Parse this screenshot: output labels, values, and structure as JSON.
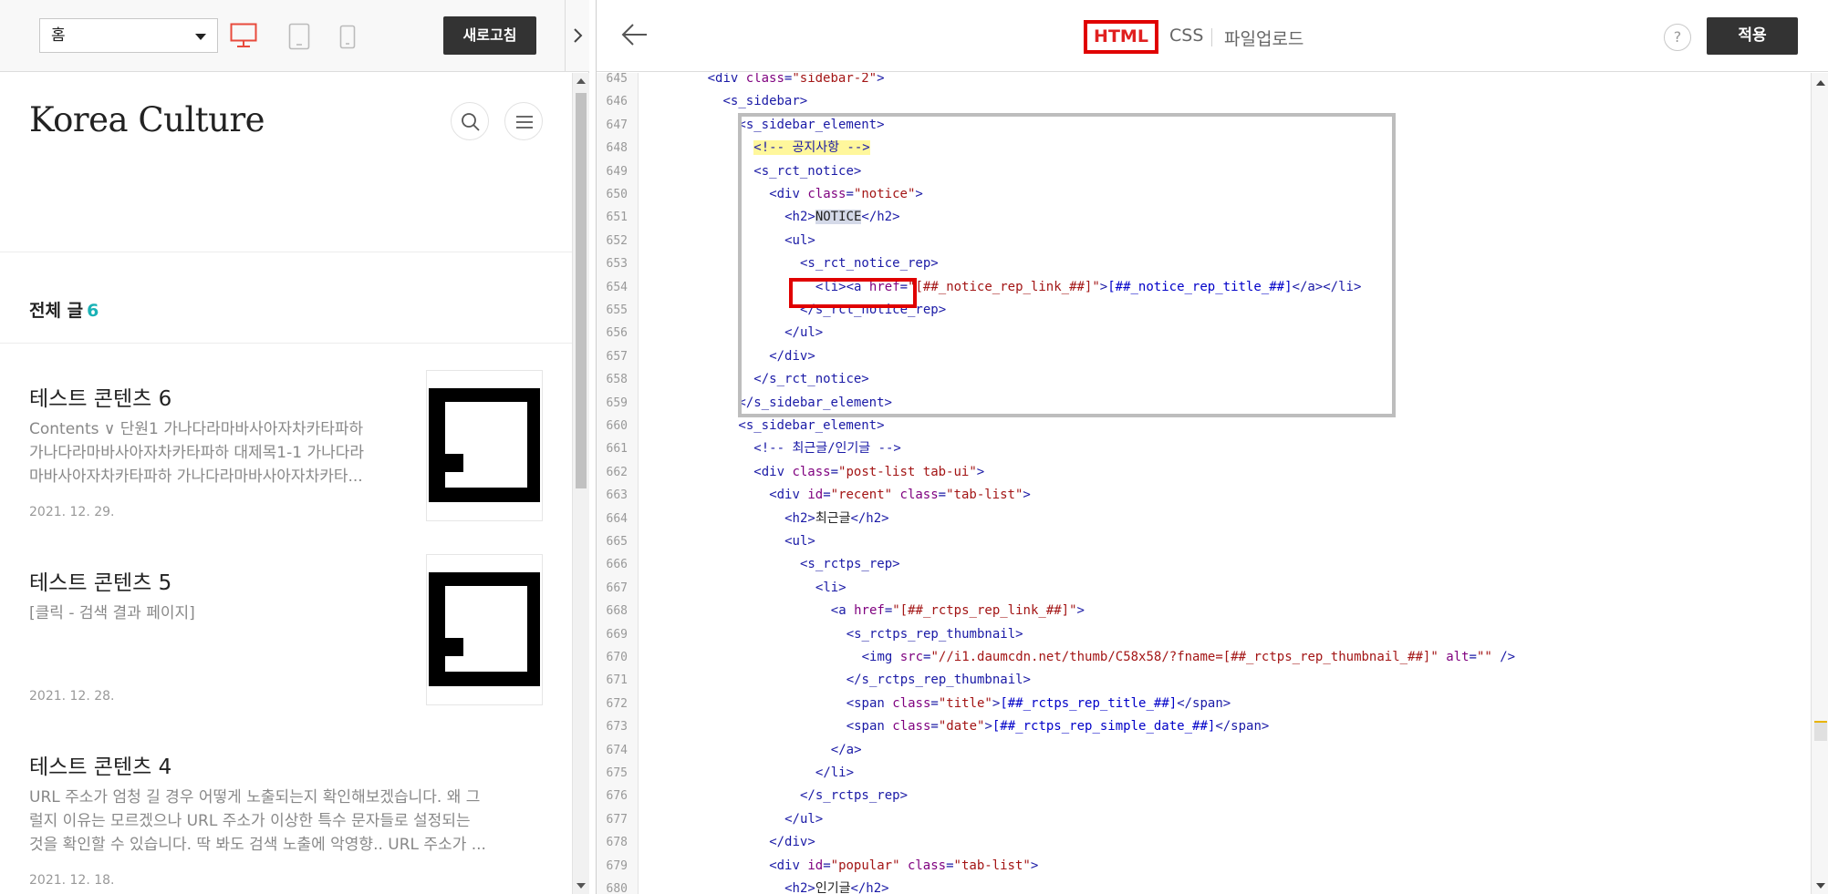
{
  "left_toolbar": {
    "page_select": "홈",
    "refresh_label": "새로고침"
  },
  "preview": {
    "blog_title": "Korea Culture",
    "total_label": "전체 글",
    "total_count": "6",
    "posts": [
      {
        "title": "테스트 콘텐츠 6",
        "excerpt_lines": [
          "Contents ∨ 단원1 가나다라마바사아자차카타파하",
          "가나다라마바사아자차카타파하 대제목1-1 가나다라",
          "마바사아자차카타파하 가나다라마바사아자차카타..."
        ],
        "date": "2021. 12. 29."
      },
      {
        "title": "테스트 콘텐츠 5",
        "excerpt_lines": [
          "[클릭 - 검색 결과 페이지]"
        ],
        "date": "2021. 12. 28."
      },
      {
        "title": "테스트 콘텐츠 4",
        "excerpt_lines": [
          "URL 주소가 엄청 길 경우 어떻게 노출되는지 확인해보겠습니다. 왜 그",
          "럴지 이유는 모르겠으나 URL 주소가 이상한 특수 문자들로 설정되는",
          "것을 확인할 수 있습니다. 딱 봐도 검색 노출에 악영향.. URL 주소가 ..."
        ],
        "date": "2021. 12. 18."
      }
    ]
  },
  "editor_toolbar": {
    "tab_html": "HTML",
    "tab_css": "CSS",
    "tab_upload": "파일업로드",
    "help": "?",
    "apply_label": "적용"
  },
  "colors": {
    "accent_red": "#e00000",
    "count_teal": "#1ab2b6",
    "button_dark": "#333333"
  },
  "code_lines": [
    {
      "n": "645",
      "indent": 4,
      "parts": [
        [
          "tag",
          "<div "
        ],
        [
          "attr",
          "class"
        ],
        [
          "tag",
          "="
        ],
        [
          "str",
          "\"sidebar-2\""
        ],
        [
          "tag",
          ">"
        ]
      ]
    },
    {
      "n": "646",
      "indent": 5,
      "parts": [
        [
          "tag",
          "<s_sidebar>"
        ]
      ]
    },
    {
      "n": "647",
      "indent": 6,
      "parts": [
        [
          "tag",
          "<s_sidebar_element>"
        ]
      ]
    },
    {
      "n": "648",
      "indent": 7,
      "parts": [
        [
          "comy",
          "<!-- 공지사항 -->"
        ]
      ]
    },
    {
      "n": "649",
      "indent": 7,
      "parts": [
        [
          "tag",
          "<s_rct_notice>"
        ]
      ]
    },
    {
      "n": "650",
      "indent": 8,
      "parts": [
        [
          "tag",
          "<div "
        ],
        [
          "attr",
          "class"
        ],
        [
          "tag",
          "="
        ],
        [
          "str",
          "\"notice\""
        ],
        [
          "tag",
          ">"
        ]
      ]
    },
    {
      "n": "651",
      "indent": 9,
      "parts": [
        [
          "tag",
          "<h2>"
        ],
        [
          "sel",
          "NOTICE"
        ],
        [
          "tag",
          "</h2>"
        ]
      ]
    },
    {
      "n": "652",
      "indent": 9,
      "parts": [
        [
          "tag",
          "<ul>"
        ]
      ]
    },
    {
      "n": "653",
      "indent": 10,
      "parts": [
        [
          "tag",
          "<s_rct_notice_rep>"
        ]
      ]
    },
    {
      "n": "654",
      "indent": 11,
      "parts": [
        [
          "tag",
          "<li><a "
        ],
        [
          "attr",
          "href"
        ],
        [
          "tag",
          "="
        ],
        [
          "str",
          "\"[##_notice_rep_link_##]\""
        ],
        [
          "tag",
          ">"
        ],
        [
          "var",
          "[##_notice_rep_title_##]"
        ],
        [
          "tag",
          "</a></li>"
        ]
      ]
    },
    {
      "n": "655",
      "indent": 10,
      "parts": [
        [
          "tag",
          "</s_rct_notice_rep>"
        ]
      ]
    },
    {
      "n": "656",
      "indent": 9,
      "parts": [
        [
          "tag",
          "</ul>"
        ]
      ]
    },
    {
      "n": "657",
      "indent": 8,
      "parts": [
        [
          "tag",
          "</div>"
        ]
      ]
    },
    {
      "n": "658",
      "indent": 7,
      "parts": [
        [
          "tag",
          "</s_rct_notice>"
        ]
      ]
    },
    {
      "n": "659",
      "indent": 6,
      "parts": [
        [
          "tag",
          "</s_sidebar_element>"
        ]
      ]
    },
    {
      "n": "660",
      "indent": 6,
      "parts": [
        [
          "tag",
          "<s_sidebar_element>"
        ]
      ]
    },
    {
      "n": "661",
      "indent": 7,
      "parts": [
        [
          "com",
          "<!-- 최근글/인기글 -->"
        ]
      ]
    },
    {
      "n": "662",
      "indent": 7,
      "parts": [
        [
          "tag",
          "<div "
        ],
        [
          "attr",
          "class"
        ],
        [
          "tag",
          "="
        ],
        [
          "str",
          "\"post-list tab-ui\""
        ],
        [
          "tag",
          ">"
        ]
      ]
    },
    {
      "n": "663",
      "indent": 8,
      "parts": [
        [
          "tag",
          "<div "
        ],
        [
          "attr",
          "id"
        ],
        [
          "tag",
          "="
        ],
        [
          "str",
          "\"recent\""
        ],
        [
          "tag",
          " "
        ],
        [
          "attr",
          "class"
        ],
        [
          "tag",
          "="
        ],
        [
          "str",
          "\"tab-list\""
        ],
        [
          "tag",
          ">"
        ]
      ]
    },
    {
      "n": "664",
      "indent": 9,
      "parts": [
        [
          "tag",
          "<h2>"
        ],
        [
          "txt",
          "최근글"
        ],
        [
          "tag",
          "</h2>"
        ]
      ]
    },
    {
      "n": "665",
      "indent": 9,
      "parts": [
        [
          "tag",
          "<ul>"
        ]
      ]
    },
    {
      "n": "666",
      "indent": 10,
      "parts": [
        [
          "tag",
          "<s_rctps_rep>"
        ]
      ]
    },
    {
      "n": "667",
      "indent": 11,
      "parts": [
        [
          "tag",
          "<li>"
        ]
      ]
    },
    {
      "n": "668",
      "indent": 12,
      "parts": [
        [
          "tag",
          "<a "
        ],
        [
          "attr",
          "href"
        ],
        [
          "tag",
          "="
        ],
        [
          "str",
          "\"[##_rctps_rep_link_##]\""
        ],
        [
          "tag",
          ">"
        ]
      ]
    },
    {
      "n": "669",
      "indent": 13,
      "parts": [
        [
          "tag",
          "<s_rctps_rep_thumbnail>"
        ]
      ]
    },
    {
      "n": "670",
      "indent": 14,
      "parts": [
        [
          "tag",
          "<img "
        ],
        [
          "attr",
          "src"
        ],
        [
          "tag",
          "="
        ],
        [
          "str",
          "\"//i1.daumcdn.net/thumb/C58x58/?fname=[##_rctps_rep_thumbnail_##]\""
        ],
        [
          "tag",
          " "
        ],
        [
          "attr",
          "alt"
        ],
        [
          "tag",
          "="
        ],
        [
          "str",
          "\"\""
        ],
        [
          "tag",
          " />"
        ]
      ]
    },
    {
      "n": "671",
      "indent": 13,
      "parts": [
        [
          "tag",
          "</s_rctps_rep_thumbnail>"
        ]
      ]
    },
    {
      "n": "672",
      "indent": 13,
      "parts": [
        [
          "tag",
          "<span "
        ],
        [
          "attr",
          "class"
        ],
        [
          "tag",
          "="
        ],
        [
          "str",
          "\"title\""
        ],
        [
          "tag",
          ">"
        ],
        [
          "var",
          "[##_rctps_rep_title_##]"
        ],
        [
          "tag",
          "</span>"
        ]
      ]
    },
    {
      "n": "673",
      "indent": 13,
      "parts": [
        [
          "tag",
          "<span "
        ],
        [
          "attr",
          "class"
        ],
        [
          "tag",
          "="
        ],
        [
          "str",
          "\"date\""
        ],
        [
          "tag",
          ">"
        ],
        [
          "var",
          "[##_rctps_rep_simple_date_##]"
        ],
        [
          "tag",
          "</span>"
        ]
      ]
    },
    {
      "n": "674",
      "indent": 12,
      "parts": [
        [
          "tag",
          "</a>"
        ]
      ]
    },
    {
      "n": "675",
      "indent": 11,
      "parts": [
        [
          "tag",
          "</li>"
        ]
      ]
    },
    {
      "n": "676",
      "indent": 10,
      "parts": [
        [
          "tag",
          "</s_rctps_rep>"
        ]
      ]
    },
    {
      "n": "677",
      "indent": 9,
      "parts": [
        [
          "tag",
          "</ul>"
        ]
      ]
    },
    {
      "n": "678",
      "indent": 8,
      "parts": [
        [
          "tag",
          "</div>"
        ]
      ]
    },
    {
      "n": "679",
      "indent": 8,
      "parts": [
        [
          "tag",
          "<div "
        ],
        [
          "attr",
          "id"
        ],
        [
          "tag",
          "="
        ],
        [
          "str",
          "\"popular\""
        ],
        [
          "tag",
          " "
        ],
        [
          "attr",
          "class"
        ],
        [
          "tag",
          "="
        ],
        [
          "str",
          "\"tab-list\""
        ],
        [
          "tag",
          ">"
        ]
      ]
    },
    {
      "n": "680",
      "indent": 9,
      "parts": [
        [
          "tag",
          "<h2>"
        ],
        [
          "txt",
          "인기글"
        ],
        [
          "tag",
          "</h2>"
        ]
      ]
    }
  ]
}
